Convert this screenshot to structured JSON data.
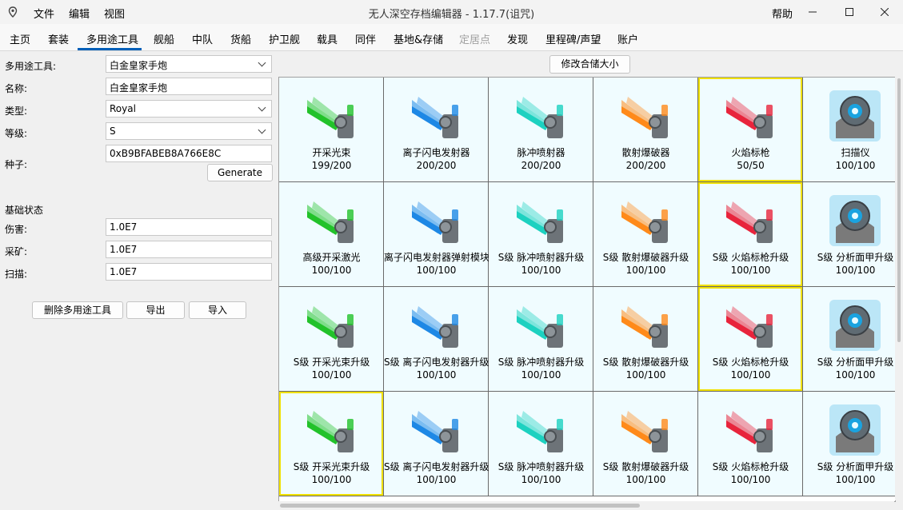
{
  "window": {
    "title": "无人深空存档编辑器 - 1.17.7(诅咒)",
    "menu": [
      "文件",
      "编辑",
      "视图"
    ],
    "help": "帮助"
  },
  "tabs": [
    {
      "label": "主页",
      "state": "normal"
    },
    {
      "label": "套装",
      "state": "normal"
    },
    {
      "label": "多用途工具",
      "state": "active"
    },
    {
      "label": "舰船",
      "state": "normal"
    },
    {
      "label": "中队",
      "state": "normal"
    },
    {
      "label": "货船",
      "state": "normal"
    },
    {
      "label": "护卫舰",
      "state": "normal"
    },
    {
      "label": "载具",
      "state": "normal"
    },
    {
      "label": "同伴",
      "state": "normal"
    },
    {
      "label": "基地&存储",
      "state": "normal"
    },
    {
      "label": "定居点",
      "state": "disabled"
    },
    {
      "label": "发现",
      "state": "normal"
    },
    {
      "label": "里程碑/声望",
      "state": "normal"
    },
    {
      "label": "账户",
      "state": "normal"
    }
  ],
  "form": {
    "multitool_label": "多用途工具:",
    "multitool_value": "白金皇家手炮",
    "name_label": "名称:",
    "name_value": "白金皇家手炮",
    "type_label": "类型:",
    "type_value": "Royal",
    "class_label": "等级:",
    "class_value": "S",
    "seed_label": "种子:",
    "seed_value": "0xB9BFABEB8A766E8C",
    "generate_label": "Generate",
    "stats_heading": "基础状态",
    "damage_label": "伤害:",
    "damage_value": "1.0E7",
    "mining_label": "采矿:",
    "mining_value": "1.0E7",
    "scan_label": "扫描:",
    "scan_value": "1.0E7",
    "delete_label": "删除多用途工具",
    "export_label": "导出",
    "import_label": "导入"
  },
  "resize_label": "修改合储大小",
  "tech_colors": {
    "mining": "#22c22a",
    "ion": "#1e88e5",
    "pulse": "#1dd1c0",
    "scatter": "#ff8a1a",
    "flame": "#e8243c",
    "scanner": "#1aa3e0"
  },
  "grid": [
    [
      {
        "name": "开采光束",
        "qty": "199/200",
        "tech": "mining",
        "icon": "mining-beam-icon"
      },
      {
        "name": "离子闪电发射器",
        "qty": "200/200",
        "tech": "ion",
        "icon": "ion-launcher-icon"
      },
      {
        "name": "脉冲喷射器",
        "qty": "200/200",
        "tech": "pulse",
        "icon": "pulse-spitter-icon"
      },
      {
        "name": "散射爆破器",
        "qty": "200/200",
        "tech": "scatter",
        "icon": "scatter-blaster-icon"
      },
      {
        "name": "火焰标枪",
        "qty": "50/50",
        "tech": "flame",
        "icon": "flame-lance-icon",
        "selected": true
      },
      {
        "name": "扫描仪",
        "qty": "100/100",
        "tech": "scanner",
        "icon": "scanner-icon"
      }
    ],
    [
      {
        "name": "高级开采激光",
        "qty": "100/100",
        "tech": "mining",
        "icon": "advanced-mining-laser-icon"
      },
      {
        "name": "离子闪电发射器弹射模块",
        "qty": "100/100",
        "tech": "ion",
        "icon": "ion-launcher-module-icon"
      },
      {
        "name": "S级 脉冲喷射器升级",
        "qty": "100/100",
        "tech": "pulse",
        "icon": "pulse-spitter-upgrade-icon"
      },
      {
        "name": "S级 散射爆破器升级",
        "qty": "100/100",
        "tech": "scatter",
        "icon": "scatter-blaster-upgrade-icon"
      },
      {
        "name": "S级 火焰标枪升级",
        "qty": "100/100",
        "tech": "flame",
        "icon": "flame-lance-upgrade-icon",
        "selected": true
      },
      {
        "name": "S级 分析面甲升级",
        "qty": "100/100",
        "tech": "scanner",
        "icon": "analysis-visor-upgrade-icon"
      }
    ],
    [
      {
        "name": "S级 开采光束升级",
        "qty": "100/100",
        "tech": "mining",
        "icon": "mining-beam-upgrade-icon"
      },
      {
        "name": "S级 离子闪电发射器升级",
        "qty": "100/100",
        "tech": "ion",
        "icon": "ion-launcher-upgrade-icon"
      },
      {
        "name": "S级 脉冲喷射器升级",
        "qty": "100/100",
        "tech": "pulse",
        "icon": "pulse-spitter-upgrade-icon"
      },
      {
        "name": "S级 散射爆破器升级",
        "qty": "100/100",
        "tech": "scatter",
        "icon": "scatter-blaster-upgrade-icon"
      },
      {
        "name": "S级 火焰标枪升级",
        "qty": "100/100",
        "tech": "flame",
        "icon": "flame-lance-upgrade-icon",
        "selected": true
      },
      {
        "name": "S级 分析面甲升级",
        "qty": "100/100",
        "tech": "scanner",
        "icon": "analysis-visor-upgrade-icon"
      }
    ],
    [
      {
        "name": "S级 开采光束升级",
        "qty": "100/100",
        "tech": "mining",
        "icon": "mining-beam-upgrade-icon",
        "selected": true
      },
      {
        "name": "S级 离子闪电发射器升级",
        "qty": "100/100",
        "tech": "ion",
        "icon": "ion-launcher-upgrade-icon"
      },
      {
        "name": "S级 脉冲喷射器升级",
        "qty": "100/100",
        "tech": "pulse",
        "icon": "pulse-spitter-upgrade-icon"
      },
      {
        "name": "S级 散射爆破器升级",
        "qty": "100/100",
        "tech": "scatter",
        "icon": "scatter-blaster-upgrade-icon"
      },
      {
        "name": "S级 火焰标枪升级",
        "qty": "100/100",
        "tech": "flame",
        "icon": "flame-lance-upgrade-icon"
      },
      {
        "name": "S级 分析面甲升级",
        "qty": "100/100",
        "tech": "scanner",
        "icon": "analysis-visor-upgrade-icon"
      }
    ]
  ]
}
